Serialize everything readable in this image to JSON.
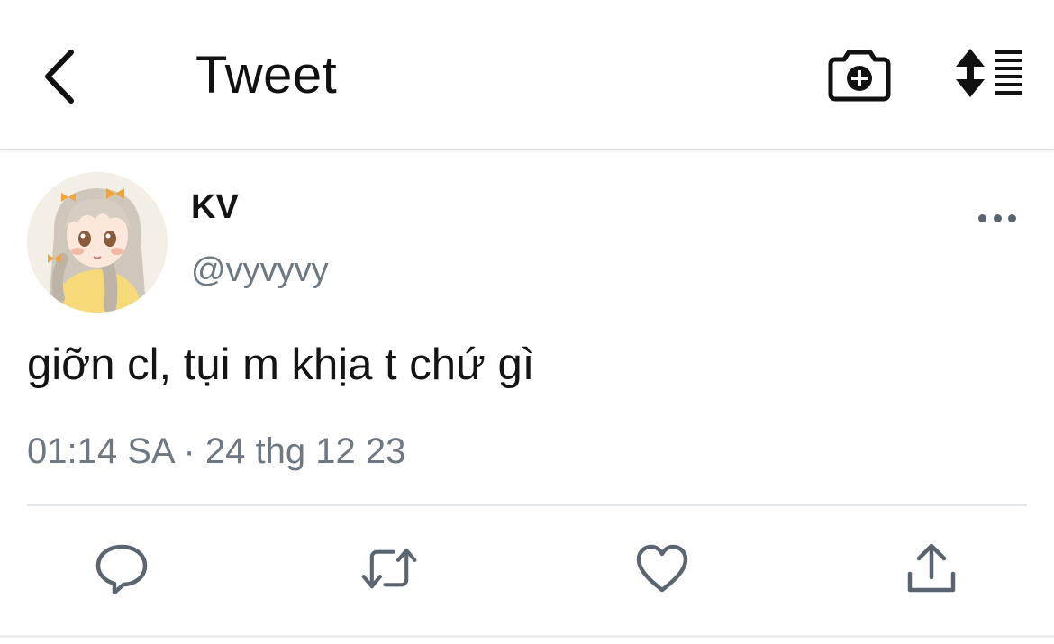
{
  "header": {
    "title": "Tweet"
  },
  "tweet": {
    "display_name": "KV",
    "handle": "@vyvyvy",
    "text": "giỡn cl, tụi m khịa t chứ gì",
    "meta": "01:14 SA · 24 thg 12 23"
  },
  "icons": {
    "back": "chevron-left-icon",
    "camera": "camera-plus-icon",
    "sort": "sort-list-icon",
    "more": "more-horizontal-icon",
    "reply": "reply-icon",
    "retweet": "retweet-icon",
    "like": "heart-icon",
    "share": "share-icon"
  },
  "colors": {
    "text": "#141414",
    "secondary": "#6e7883",
    "icon": "#5b6570",
    "divider": "#e3e6e8"
  }
}
